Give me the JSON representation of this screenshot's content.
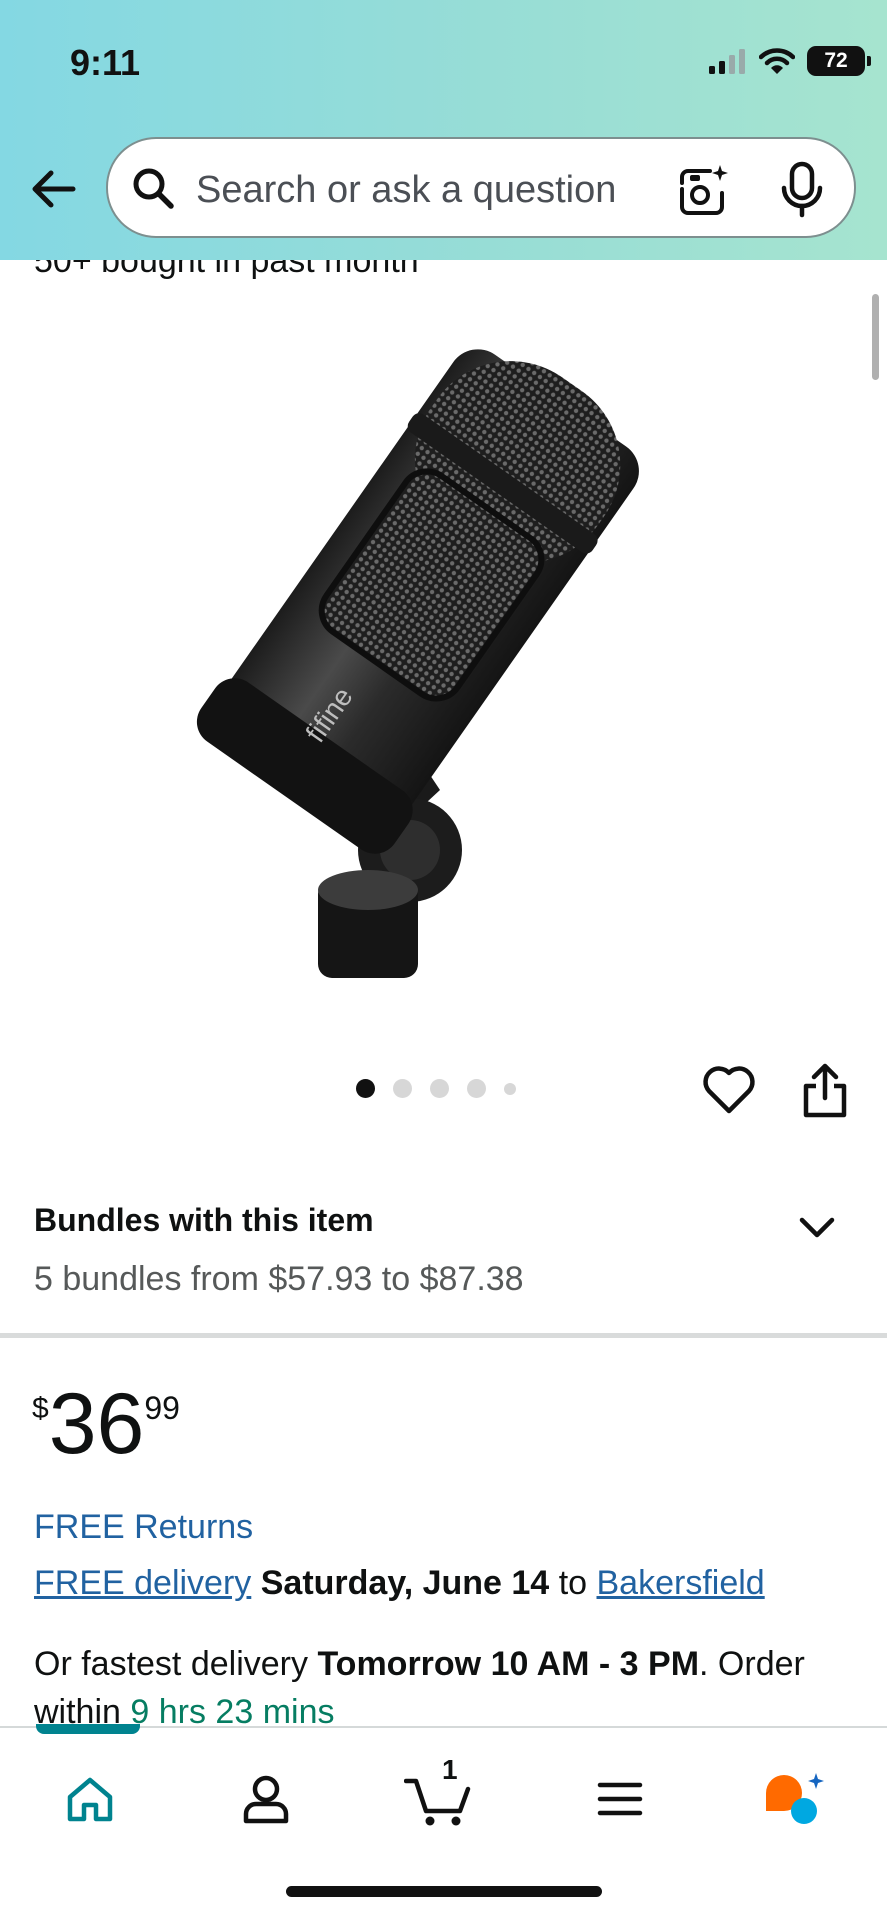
{
  "status_bar": {
    "time": "9:11",
    "battery": "72"
  },
  "search": {
    "placeholder": "Search or ask a question"
  },
  "product": {
    "partial_text": "50+ bought in past month",
    "brand_on_image": "fifine",
    "image_dots": {
      "count": 5,
      "active_index": 0
    }
  },
  "bundles": {
    "title": "Bundles with this item",
    "subtitle": "5 bundles from $57.93 to $87.38"
  },
  "price": {
    "symbol": "$",
    "whole": "36",
    "fraction": "99"
  },
  "shipping": {
    "free_returns": "FREE Returns",
    "free_delivery_link": "FREE delivery",
    "delivery_date": "Saturday, June 14",
    "to_text": "to",
    "location": "Bakersfield",
    "fast_prefix": "Or fastest delivery",
    "fast_window": "Tomorrow 10 AM - 3 PM",
    "order_within": ". Order within",
    "countdown": "9 hrs 23 mins"
  },
  "bottom_nav": {
    "items": [
      "home-icon",
      "account-icon",
      "cart-icon",
      "menu-icon",
      "rufus-icon"
    ],
    "cart_count": "1",
    "active": "home"
  },
  "colors": {
    "header_gradient_start": "#84d8e3",
    "header_gradient_end": "#a6e4cf",
    "link": "#2162a1",
    "countdown": "#067d62",
    "active_nav": "#00838f",
    "rufus_orange": "#ff6a00",
    "rufus_blue": "#00a8e1"
  }
}
